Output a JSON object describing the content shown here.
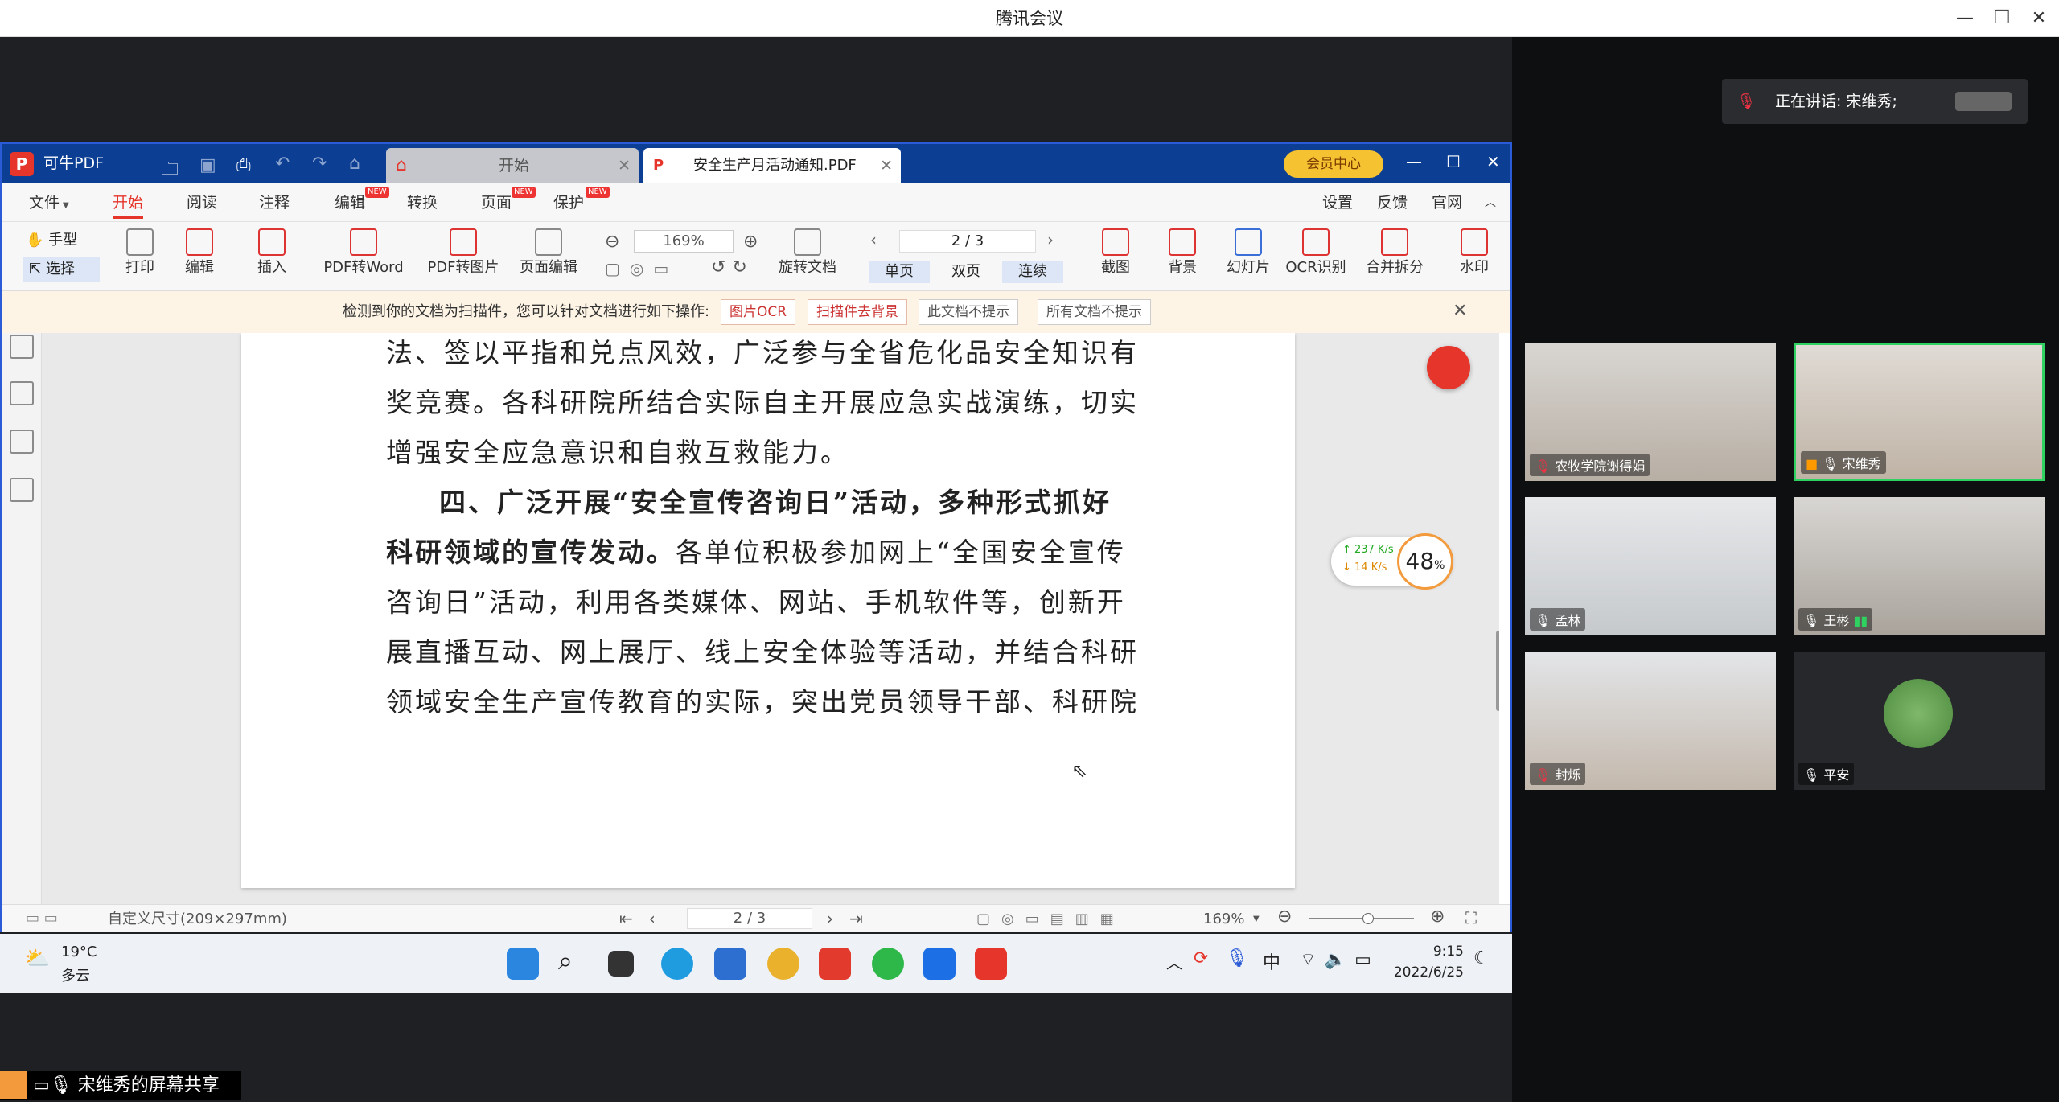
{
  "meeting": {
    "title": "腾讯会议",
    "speaking_prefix": "正在讲话: ",
    "speaking_name": "宋维秀;",
    "share_label": "宋维秀的屏幕共享"
  },
  "pdf": {
    "app_name": "可牛PDF",
    "tab_home": "开始",
    "tab_doc": "安全生产月活动通知.PDF",
    "vip_label": "会员中心",
    "menu": [
      "文件",
      "开始",
      "阅读",
      "注释",
      "编辑",
      "转换",
      "页面",
      "保护"
    ],
    "menu_right": [
      "设置",
      "反馈",
      "官网"
    ],
    "new_tag": "NEW",
    "tools": {
      "hand": "手型",
      "select": "选择",
      "print": "打印",
      "edit": "编辑",
      "insert": "插入",
      "pdf2word": "PDF转Word",
      "pdf2img": "PDF转图片",
      "page_edit": "页面编辑",
      "zoom": "169%",
      "page": "2 / 3",
      "rotate": "旋转文档",
      "single": "单页",
      "double": "双页",
      "continuous": "连续",
      "screenshot": "截图",
      "background": "背景",
      "slides": "幻灯片",
      "ocr": "OCR识别",
      "merge": "合并拆分",
      "watermark": "水印"
    },
    "notice": {
      "text": "检测到你的文档为扫描件，您可以针对文档进行如下操作:",
      "btn1": "图片OCR",
      "btn2": "扫描件去背景",
      "btn3": "此文档不提示",
      "btn4": "所有文档不提示"
    },
    "doc_lines": [
      "法、签以平指和兑点风效，广泛参与全省危化品安全知识有",
      "奖竞赛。各科研院所结合实际自主开展应急实战演练，切实",
      "增强安全应急意识和自救互救能力。",
      "四、广泛开展“安全宣传咨询日”活动，多种形式抓好",
      "科研领域的宣传发动。",
      "各单位积极参加网上“全国安全宣传",
      "咨询日”活动，利用各类媒体、网站、手机软件等，创新开",
      "展直播互动、网上展厅、线上安全体验等活动，并结合科研",
      "领域安全生产宣传教育的实际，突出党员领导干部、科研院"
    ],
    "status": {
      "page_size": "自定义尺寸(209×297mm)",
      "page": "2 / 3",
      "zoom": "169%"
    },
    "net": {
      "up": "237 K/s",
      "down": "14 K/s",
      "percent": "48",
      "percent_unit": "%"
    }
  },
  "taskbar": {
    "temp": "19°C",
    "weather": "多云",
    "ime": "中",
    "time": "9:15",
    "date": "2022/6/25"
  },
  "participants": [
    {
      "name": "农牧学院谢得娟"
    },
    {
      "name": "宋维秀"
    },
    {
      "name": "孟林"
    },
    {
      "name": "王彬"
    },
    {
      "name": "封烁"
    },
    {
      "name": "平安"
    }
  ],
  "colors": {
    "accent": "#0c3f93",
    "pdf_red": "#e6352b",
    "active_speaker": "#2fd160"
  }
}
